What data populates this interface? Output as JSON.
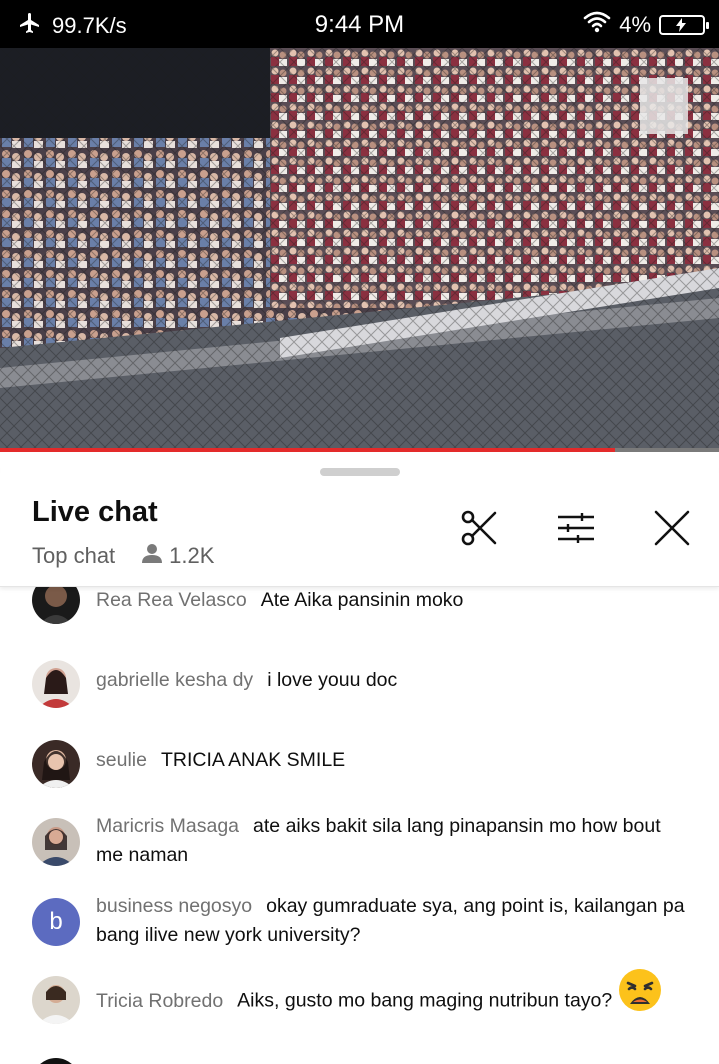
{
  "status_bar": {
    "net_speed": "99.7K/s",
    "time": "9:44 PM",
    "battery": "4%"
  },
  "video": {
    "progress": 0.855
  },
  "chat": {
    "title": "Live chat",
    "mode": "Top chat",
    "viewers": "1.2K",
    "messages": [
      {
        "author": "Rea Rea Velasco",
        "text": "Ate Aika pansinin moko",
        "avatar_color": "#1a1a1a"
      },
      {
        "author": "gabrielle kesha dy",
        "text": "i love youu doc",
        "avatar_color": "#b85a4a"
      },
      {
        "author": "seulie",
        "text": "TRICIA ANAK SMILE",
        "avatar_color": "#2b2220"
      },
      {
        "author": "Maricris Masaga",
        "text": "ate aiks bakit sila lang pinapansin mo how bout me naman",
        "avatar_color": "#8a7066"
      },
      {
        "author": "business negosyo",
        "text": "okay gumraduate sya, ang point is, kailangan pa bang ilive new york university?",
        "avatar_letter": "b",
        "avatar_color": "#5c6bc0"
      },
      {
        "author": "Tricia Robredo",
        "text": "Aiks, gusto mo bang maging nutribun tayo?",
        "avatar_color": "#9a8a70",
        "emoji": "weary-face-emoji"
      }
    ]
  },
  "colors": {
    "progress": "#e32a2a",
    "author": "#717171",
    "accent_avatar": "#5c6bc0"
  }
}
